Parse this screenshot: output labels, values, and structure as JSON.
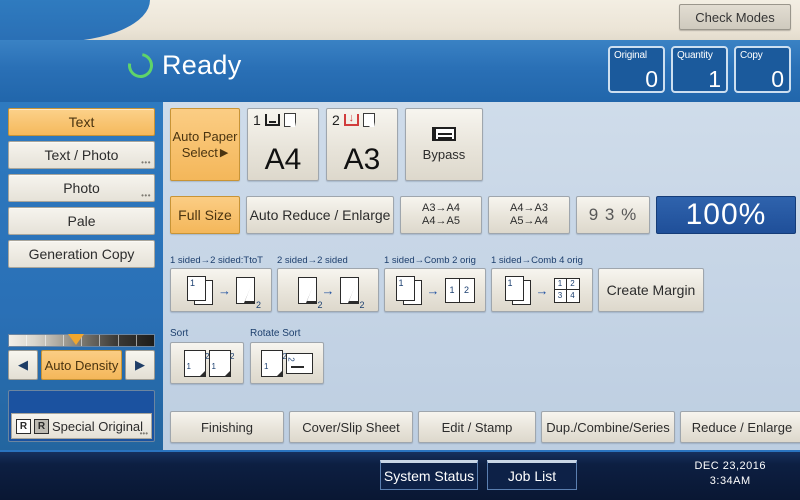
{
  "header": {
    "check_modes_label": "Check Modes"
  },
  "status": {
    "ready_label": "Ready",
    "ready_icon": "ready-ring-icon",
    "counters": [
      {
        "label": "Original",
        "value": "0"
      },
      {
        "label": "Quantity",
        "value": "1"
      },
      {
        "label": "Copy",
        "value": "0"
      }
    ]
  },
  "sidebar": {
    "quality_buttons": [
      {
        "label": "Text",
        "selected": true,
        "dots": ""
      },
      {
        "label": "Text / Photo",
        "selected": false,
        "dots": "•••"
      },
      {
        "label": "Photo",
        "selected": false,
        "dots": "•••"
      },
      {
        "label": "Pale",
        "selected": false,
        "dots": ""
      },
      {
        "label": "Generation Copy",
        "selected": false,
        "dots": ""
      }
    ],
    "density": {
      "label": "Auto Density",
      "left_arrow": "◀",
      "right_arrow": "▶",
      "pointer_position_percent": 42
    },
    "special_original": {
      "label": "Special Original",
      "icon_1": "R",
      "icon_2": "R",
      "dots": "•••"
    }
  },
  "main": {
    "paper_select": {
      "auto_label_line1": "Auto Paper",
      "auto_label_line2": "Select",
      "auto_arrow": "▶",
      "trays": [
        {
          "number": "1",
          "size": "A4",
          "low_paper": false
        },
        {
          "number": "2",
          "size": "A3",
          "low_paper": true
        }
      ],
      "bypass_label": "Bypass"
    },
    "zoom": {
      "full_size_label": "Full Size",
      "auto_reduce_label": "Auto Reduce / Enlarge",
      "ratio_a": {
        "line1": "A3→A4",
        "line2": "A4→A5"
      },
      "ratio_b": {
        "line1": "A4→A3",
        "line2": "A5→A4"
      },
      "preset_93": "9 3 %",
      "current_zoom": "100%"
    },
    "duplex": {
      "labels": [
        "1 sided→2 sided:TtoT",
        "2 sided→2 sided",
        "1 sided→Comb 2 orig",
        "1 sided→Comb 4 orig"
      ],
      "create_margin_label": "Create Margin",
      "page_numbers": [
        "1",
        "2",
        "3",
        "4"
      ],
      "arrow": "→"
    },
    "sort": {
      "sort_label": "Sort",
      "rotate_sort_label": "Rotate Sort",
      "page_numbers": [
        "1",
        "2"
      ]
    },
    "tabs": [
      "Finishing",
      "Cover/Slip Sheet",
      "Edit / Stamp",
      "Dup./Combine/Series",
      "Reduce / Enlarge"
    ]
  },
  "bottom": {
    "system_status_label": "System Status",
    "job_list_label": "Job List",
    "date": "DEC  23,2016",
    "time": "3:34AM"
  },
  "colors": {
    "accent_orange": "#f4b75a",
    "header_blue": "#2a70b6",
    "zoom_blue": "#1f4f99",
    "ready_green": "#5fd46a",
    "low_paper_red": "#d13d3d"
  }
}
